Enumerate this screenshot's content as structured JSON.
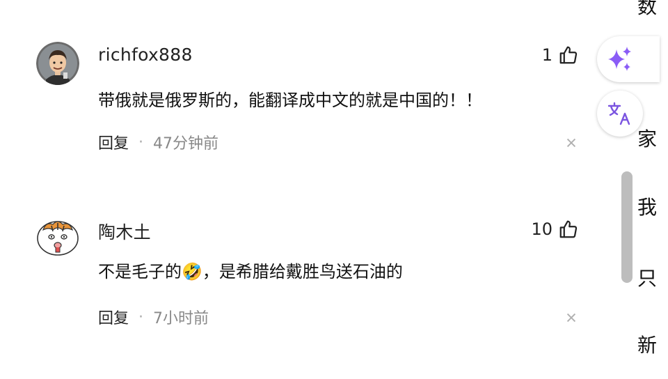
{
  "comments": [
    {
      "username": "richfox888",
      "likes": "1",
      "text": "带俄就是俄罗斯的，能翻译成中文的就是中国的！！",
      "reply_label": "回复",
      "separator": "·",
      "time": "47分钟前"
    },
    {
      "username": "陶木土",
      "likes": "10",
      "text_before": "不是毛子的",
      "emoji": "🤣",
      "text_after": "，是希腊给戴胜鸟送石油的",
      "reply_label": "回复",
      "separator": "·",
      "time": "7小时前"
    }
  ],
  "right_edge": {
    "chars": [
      "家",
      "我",
      "只",
      "新"
    ]
  },
  "colors": {
    "ai_accent": "#8a5cf6",
    "translate_accent": "#7b55e0",
    "meta_text": "#888888"
  },
  "icons": [
    "thumbs-up-icon",
    "close-icon",
    "sparkle-icon",
    "translate-icon"
  ]
}
